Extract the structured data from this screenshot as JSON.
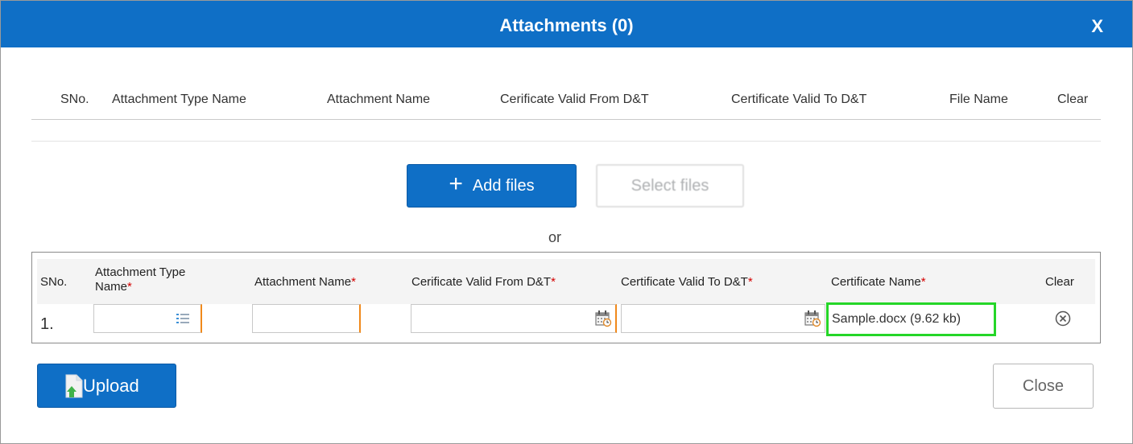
{
  "dialog": {
    "title": "Attachments (0)",
    "close_symbol": "X"
  },
  "attached_table": {
    "headers": [
      "SNo.",
      "Attachment Type Name",
      "Attachment Name",
      "Cerificate Valid From D&T",
      "Certificate Valid To D&T",
      "File Name",
      "Clear"
    ]
  },
  "actions": {
    "add_files_label": "Add files",
    "add_icon": "+",
    "select_files_label": "Select files",
    "or_label": "or"
  },
  "queue_table": {
    "headers": {
      "sno": "SNo.",
      "attachment_type_line1": "Attachment Type",
      "attachment_type_line2": "Name",
      "attachment_name": "Attachment Name",
      "valid_from": "Cerificate Valid From D&T",
      "valid_to": "Certificate Valid To D&T",
      "certificate_name": "Certificate Name",
      "clear": "Clear",
      "required_mark": "*"
    },
    "rows": [
      {
        "sno": "1.",
        "attachment_type": "",
        "attachment_name": "",
        "valid_from": "",
        "valid_to": "",
        "certificate_name": "Sample.docx (9.62 kb)"
      }
    ]
  },
  "footer": {
    "upload_label": "Upload",
    "close_label": "Close"
  },
  "colors": {
    "primary": "#0f6fc6",
    "required": "#d40000",
    "highlight": "#25d628",
    "field_accent": "#f0891b"
  },
  "icons": {
    "list": "list-icon",
    "calendar": "calendar-icon",
    "clear": "clear-circle-icon",
    "upload": "document-upload-icon"
  }
}
